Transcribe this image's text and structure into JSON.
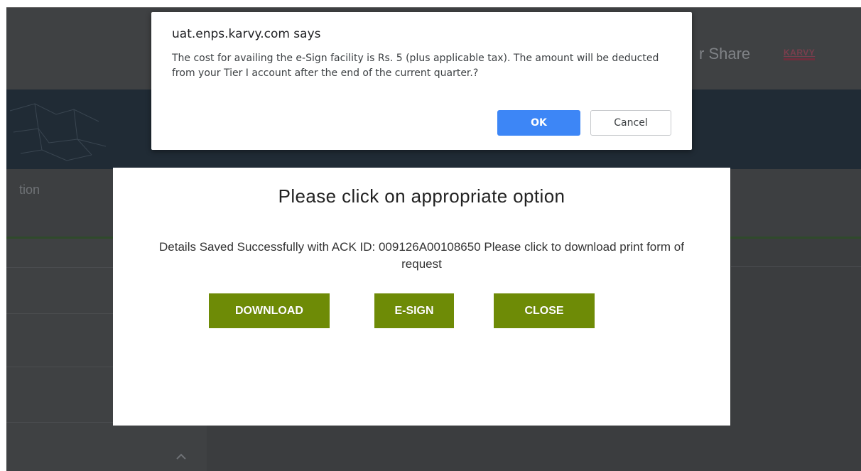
{
  "background": {
    "header_text": "r Share",
    "logo_text": "KARVY",
    "nav_text": "tion"
  },
  "confirm_dialog": {
    "title": "uat.enps.karvy.com says",
    "message": "The cost for availing the e-Sign facility is Rs. 5 (plus applicable tax). The amount will be deducted from your Tier I account after the end of the current quarter.?",
    "ok_label": "OK",
    "cancel_label": "Cancel",
    "accent_color": "#3d86f6"
  },
  "modal": {
    "title": "Please click on appropriate option",
    "message": "Details Saved Successfully with ACK ID: 009126A00108650 Please click to download print form of request",
    "buttons": {
      "download": "DOWNLOAD",
      "esign": "E-SIGN",
      "close": "CLOSE"
    },
    "button_color": "#6e8b06"
  }
}
